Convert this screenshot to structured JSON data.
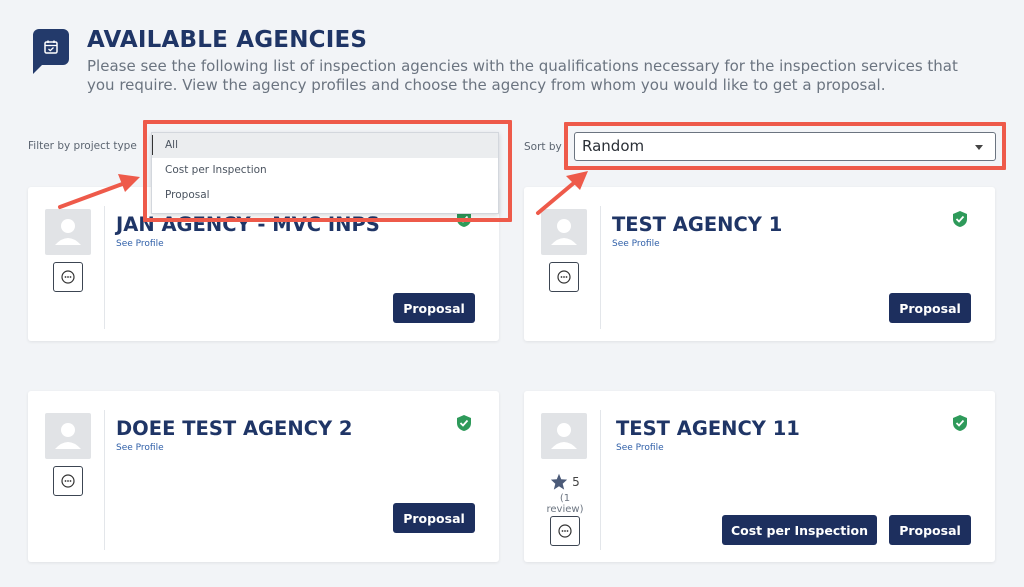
{
  "header": {
    "title": "AVAILABLE AGENCIES",
    "description": "Please see the following list of inspection agencies with the qualifications necessary for the inspection services that you require. View the agency profiles and choose the agency from whom you would like to get a proposal."
  },
  "filter": {
    "label": "Filter by project type",
    "options": [
      "All",
      "Cost per Inspection",
      "Proposal"
    ],
    "selected": "All"
  },
  "sort": {
    "label": "Sort by",
    "value": "Random"
  },
  "agencies": [
    {
      "name": "JAN AGENCY - MVC INPS",
      "see_profile": "See Profile",
      "verified": true,
      "buttons": [
        "Proposal"
      ]
    },
    {
      "name": "TEST AGENCY 1",
      "see_profile": "See Profile",
      "verified": true,
      "buttons": [
        "Proposal"
      ]
    },
    {
      "name": "DOEE TEST AGENCY 2",
      "see_profile": "See Profile",
      "verified": true,
      "buttons": [
        "Proposal"
      ]
    },
    {
      "name": "TEST AGENCY 11",
      "see_profile": "See Profile",
      "verified": true,
      "rating": "5",
      "reviews": "(1 review)",
      "buttons": [
        "Cost per Inspection",
        "Proposal"
      ]
    }
  ],
  "colors": {
    "primary": "#1d2f5e",
    "highlight": "#ee5a4a",
    "verified": "#2e9a5a",
    "link": "#2f5fa8"
  }
}
